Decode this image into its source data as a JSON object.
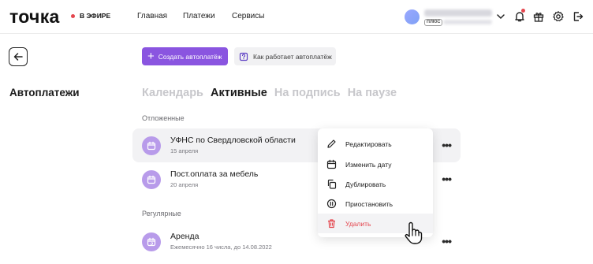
{
  "header": {
    "logo": "точка",
    "live_label": "В ЭФИРЕ",
    "nav": [
      "Главная",
      "Платежи",
      "Сервисы"
    ],
    "plan_badge": "ПЛЮС"
  },
  "page": {
    "title": "Автоплатежи",
    "create_button": "Создать автоплатёж",
    "how_button": "Как работает автоплатёж"
  },
  "tabs": [
    "Календарь",
    "Активные",
    "На подпись",
    "На паузе"
  ],
  "active_tab": "Активные",
  "sections": {
    "deferred": "Отложенные",
    "regular": "Регулярные"
  },
  "payments": [
    {
      "title": "УФНС по Свердловской области",
      "subtitle": "15 апреля"
    },
    {
      "title": "Пост.оплата за мебель",
      "subtitle": "20 апреля"
    },
    {
      "title": "Аренда",
      "subtitle": "Ежемесячно 16 числа, до 14.08.2022"
    }
  ],
  "context_menu": [
    "Редактировать",
    "Изменить дату",
    "Дублировать",
    "Приостановить",
    "Удалить"
  ],
  "colors": {
    "accent": "#8a55e0",
    "danger": "#e4464e",
    "row_icon": "#b89bea"
  }
}
